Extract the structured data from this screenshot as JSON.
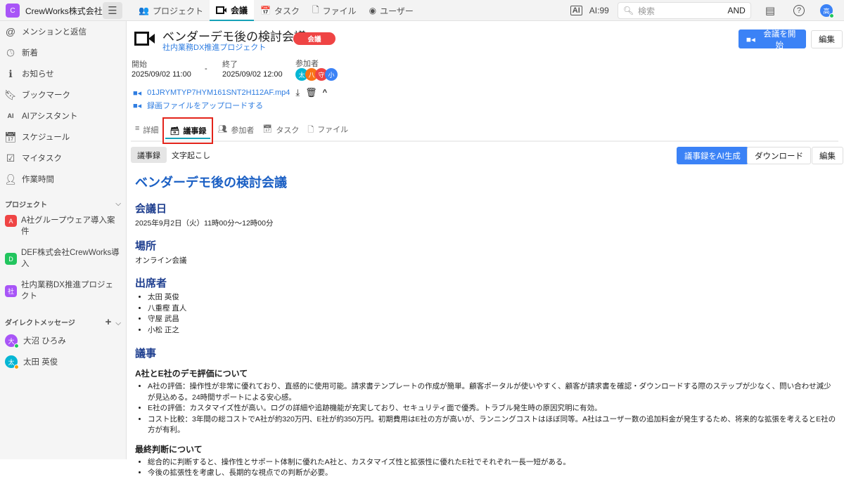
{
  "app": {
    "logo_letter": "C",
    "company": "CrewWorks株式会社"
  },
  "nav": [
    {
      "label": "プロジェクト"
    },
    {
      "label": "会議"
    },
    {
      "label": "タスク"
    },
    {
      "label": "ファイル"
    },
    {
      "label": "ユーザー"
    }
  ],
  "topright": {
    "ai_count": "AI:99",
    "search_placeholder": "検索",
    "search_mode": "AND",
    "user_initial": "高"
  },
  "sidebar": {
    "items": [
      {
        "label": "メンションと返信"
      },
      {
        "label": "新着"
      },
      {
        "label": "お知らせ"
      },
      {
        "label": "ブックマーク"
      },
      {
        "label": "AIアシスタント"
      },
      {
        "label": "スケジュール"
      },
      {
        "label": "マイタスク"
      },
      {
        "label": "作業時間"
      }
    ],
    "projects_header": "プロジェクト",
    "projects": [
      {
        "badge": "A",
        "label": "A社グループウェア導入案件",
        "color": "#ef4444"
      },
      {
        "badge": "D",
        "label": "DEF株式会社CrewWorks導入",
        "color": "#22c55e"
      },
      {
        "badge": "社",
        "label": "社内業務DX推進プロジェクト",
        "color": "#a855f7"
      }
    ],
    "dm_header": "ダイレクトメッセージ",
    "dms": [
      {
        "initial": "大",
        "name": "大沼 ひろみ",
        "color": "#a855f7",
        "status": "#22c55e"
      },
      {
        "initial": "太",
        "name": "太田 英俊",
        "color": "#06b6d4",
        "status": "#f59e0b"
      }
    ]
  },
  "meeting": {
    "title": "ベンダーデモ後の検討会議",
    "badge": "会議",
    "project": "社内業務DX推進プロジェクト",
    "start_btn": "会議を開始",
    "edit_btn": "編集",
    "start_label": "開始",
    "start": "2025/09/02 11:00",
    "sep": "-",
    "end_label": "終了",
    "end": "2025/09/02 12:00",
    "participants_label": "参加者",
    "participants": [
      {
        "i": "太",
        "c": "#06b6d4"
      },
      {
        "i": "八",
        "c": "#f97316"
      },
      {
        "i": "守",
        "c": "#ef4444"
      },
      {
        "i": "小",
        "c": "#3b82f6"
      }
    ],
    "video_file": "01JRYMTYP7HYM161SNT2H112AF.mp4",
    "upload": "録画ファイルをアップロードする"
  },
  "tabs": [
    {
      "label": "詳細"
    },
    {
      "label": "議事録"
    },
    {
      "label": "参加者"
    },
    {
      "label": "タスク"
    },
    {
      "label": "ファイル"
    }
  ],
  "subtabs": [
    {
      "label": "議事録"
    },
    {
      "label": "文字起こし"
    }
  ],
  "actions": {
    "ai_generate": "議事録をAI生成",
    "download": "ダウンロード",
    "edit": "編集"
  },
  "minutes": {
    "title": "ベンダーデモ後の検討会議",
    "date_h": "会議日",
    "date": "2025年9月2日（火）11時00分〜12時00分",
    "place_h": "場所",
    "place": "オンライン会議",
    "att_h": "出席者",
    "attendees": [
      "太田 英俊",
      "八重樫 直人",
      "守屋 武昌",
      "小松 正之"
    ],
    "agenda_h": "議事",
    "sec1_h": "A社とE社のデモ評価について",
    "sec1": [
      "A社の評価：操作性が非常に優れており、直感的に使用可能。請求書テンプレートの作成が簡単。顧客ポータルが使いやすく、顧客が請求書を確認・ダウンロードする際のステップが少なく、問い合わせ減少が見込める。24時間サポートによる安心感。",
      "E社の評価：カスタマイズ性が高い。ログの詳細や追跡機能が充実しており、セキュリティ面で優秀。トラブル発生時の原因究明に有効。",
      "コスト比較：3年間の総コストでA社が約320万円、E社が約350万円。初期費用はE社の方が高いが、ランニングコストはほぼ同等。A社はユーザー数の追加料金が発生するため、将来的な拡張を考えるとE社の方が有利。"
    ],
    "sec2_h": "最終判断について",
    "sec2": [
      "総合的に判断すると、操作性とサポート体制に優れたA社と、カスタマイズ性と拡張性に優れたE社でそれぞれ一長一短がある。",
      "今後の拡張性を考慮し、長期的な視点での判断が必要。"
    ]
  }
}
